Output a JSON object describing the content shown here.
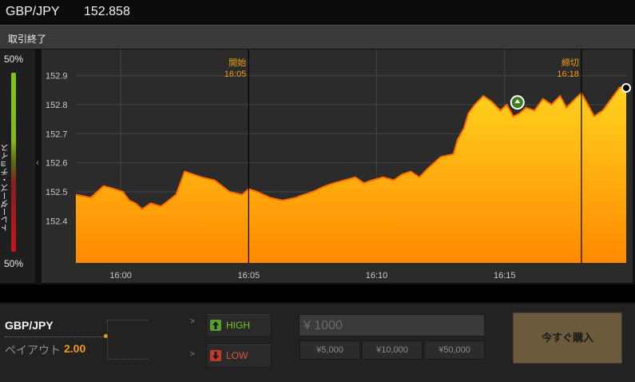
{
  "header": {
    "symbol": "GBP/JPY",
    "price": "152.858"
  },
  "status": "取引終了",
  "trader_choice": {
    "label": "トレーダーズ・チョイス",
    "top_pct": "50%",
    "bottom_pct": "50%"
  },
  "chart_data": {
    "type": "area",
    "x_ticks": [
      "16:00",
      "16:05",
      "16:10",
      "16:15"
    ],
    "y_ticks": [
      "152.9",
      "152.8",
      "152.7",
      "152.6",
      "152.5",
      "152.4"
    ],
    "xlim": [
      "15:58:15",
      "16:19:45"
    ],
    "ylim": [
      152.255,
      152.99
    ],
    "markers": [
      {
        "label": "開始",
        "time": "16:05"
      },
      {
        "label": "締切",
        "time": "16:18"
      }
    ],
    "entry_point": {
      "time": "16:15:30",
      "price": 152.808
    },
    "series": [
      {
        "x": [
          "15:58:15",
          "15:58:50",
          "15:59:20",
          "15:59:45",
          "16:00:05",
          "16:00:20",
          "16:00:35",
          "16:00:50",
          "16:01:10",
          "16:01:35",
          "16:02:10",
          "16:02:30",
          "16:02:50",
          "16:03:10",
          "16:03:40",
          "16:04:15",
          "16:04:45",
          "16:05:00",
          "16:05:20",
          "16:05:50",
          "16:06:20",
          "16:06:50",
          "16:07:10",
          "16:07:30",
          "16:08:00",
          "16:08:20",
          "16:08:45",
          "16:09:10",
          "16:09:30",
          "16:09:50",
          "16:10:15",
          "16:10:40",
          "16:11:00",
          "16:11:20",
          "16:11:40",
          "16:12:00",
          "16:12:30",
          "16:13:00",
          "16:13:10",
          "16:13:25",
          "16:13:35",
          "16:13:50",
          "16:14:10",
          "16:14:30",
          "16:14:50",
          "16:15:05",
          "16:15:20",
          "16:15:35",
          "16:15:50",
          "16:16:10",
          "16:16:30",
          "16:16:50",
          "16:17:10",
          "16:17:25",
          "16:17:45",
          "16:18:00",
          "16:18:15",
          "16:18:30",
          "16:18:50",
          "16:19:10",
          "16:19:30",
          "16:19:45"
        ],
        "y": [
          152.49,
          152.48,
          152.52,
          152.51,
          152.5,
          152.47,
          152.46,
          152.44,
          152.46,
          152.45,
          152.49,
          152.57,
          152.56,
          152.55,
          152.54,
          152.5,
          152.49,
          152.51,
          152.5,
          152.48,
          152.47,
          152.48,
          152.49,
          152.5,
          152.52,
          152.53,
          152.54,
          152.55,
          152.53,
          152.54,
          152.55,
          152.54,
          152.56,
          152.57,
          152.55,
          152.58,
          152.62,
          152.63,
          152.68,
          152.72,
          152.77,
          152.8,
          152.83,
          152.81,
          152.78,
          152.8,
          152.76,
          152.77,
          152.79,
          152.78,
          152.82,
          152.8,
          152.83,
          152.79,
          152.82,
          152.84,
          152.8,
          152.76,
          152.78,
          152.82,
          152.86,
          152.858
        ]
      }
    ]
  },
  "bottom": {
    "asset": "GBP/JPY",
    "payout_label": "ペイアウト",
    "payout_value": "2.00",
    "high_label": "HIGH",
    "low_label": "LOW",
    "amount": "¥ 1000",
    "presets": [
      "¥5,000",
      "¥10,000",
      "¥50,000"
    ],
    "buy_label": "今すぐ購入",
    "chevron": ">"
  },
  "colors": {
    "accent": "#f39c12",
    "area_top": "#ffd21f",
    "area_bottom": "#ff8a00",
    "up": "#7cc51f",
    "down": "#c4161c"
  }
}
